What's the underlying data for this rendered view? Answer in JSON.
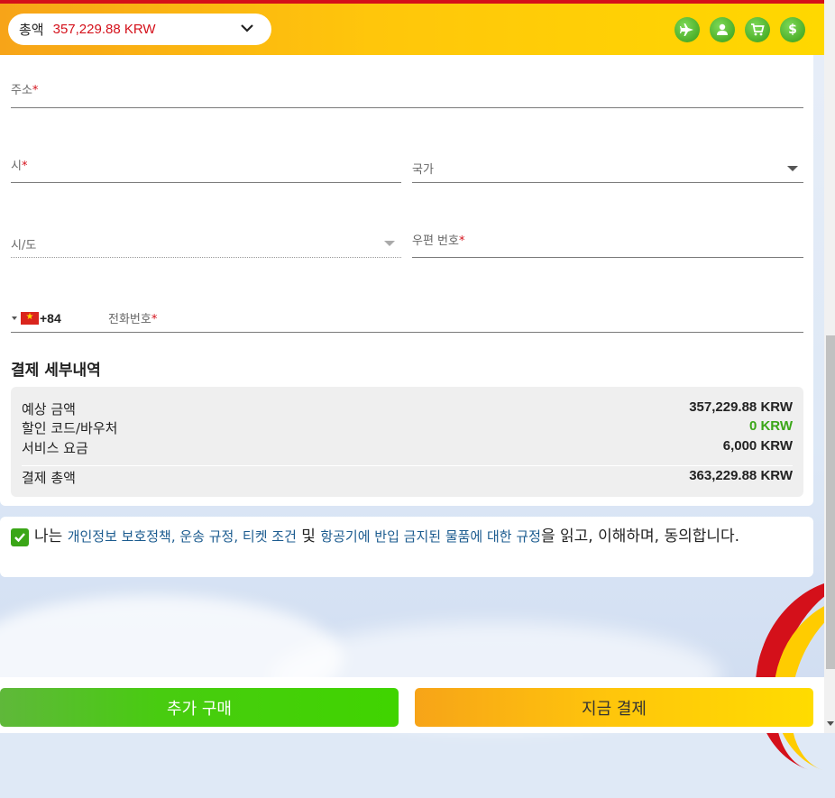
{
  "header": {
    "total_label": "총액",
    "total_value": "357,229.88 KRW",
    "icons": [
      "plane-icon",
      "user-icon",
      "cart-icon",
      "dollar-icon"
    ],
    "accent_color": "#ffc60b",
    "brand_red": "#d4101a"
  },
  "form": {
    "address_label": "주소",
    "city_label": "시",
    "country_label": "국가",
    "province_label": "시/도",
    "postal_label": "우편 번호",
    "phone_dial": "+84",
    "phone_label": "전화번호",
    "required_mark": "*"
  },
  "payment_details": {
    "title": "결제 세부내역",
    "rows": [
      {
        "label": "예상 금액",
        "value": "357,229.88 KRW"
      },
      {
        "label": "할인 코드/바우처",
        "value": "0 KRW"
      },
      {
        "label": "서비스 요금",
        "value": "6,000 KRW"
      }
    ],
    "total": {
      "label": "결제 총액",
      "value": "363,229.88 KRW"
    }
  },
  "agreement": {
    "prefix": "나는 ",
    "link1": "개인정보 보호정책, 운송 규정, 티켓 조건",
    "middle": " 및 ",
    "link2": "항공기에 반입 금지된 물품에 대한 규정",
    "suffix": "을 읽고, 이해하며, 동의합니다.",
    "checked": true
  },
  "buttons": {
    "more_label": "추가 구매",
    "pay_label": "지금 결제"
  }
}
